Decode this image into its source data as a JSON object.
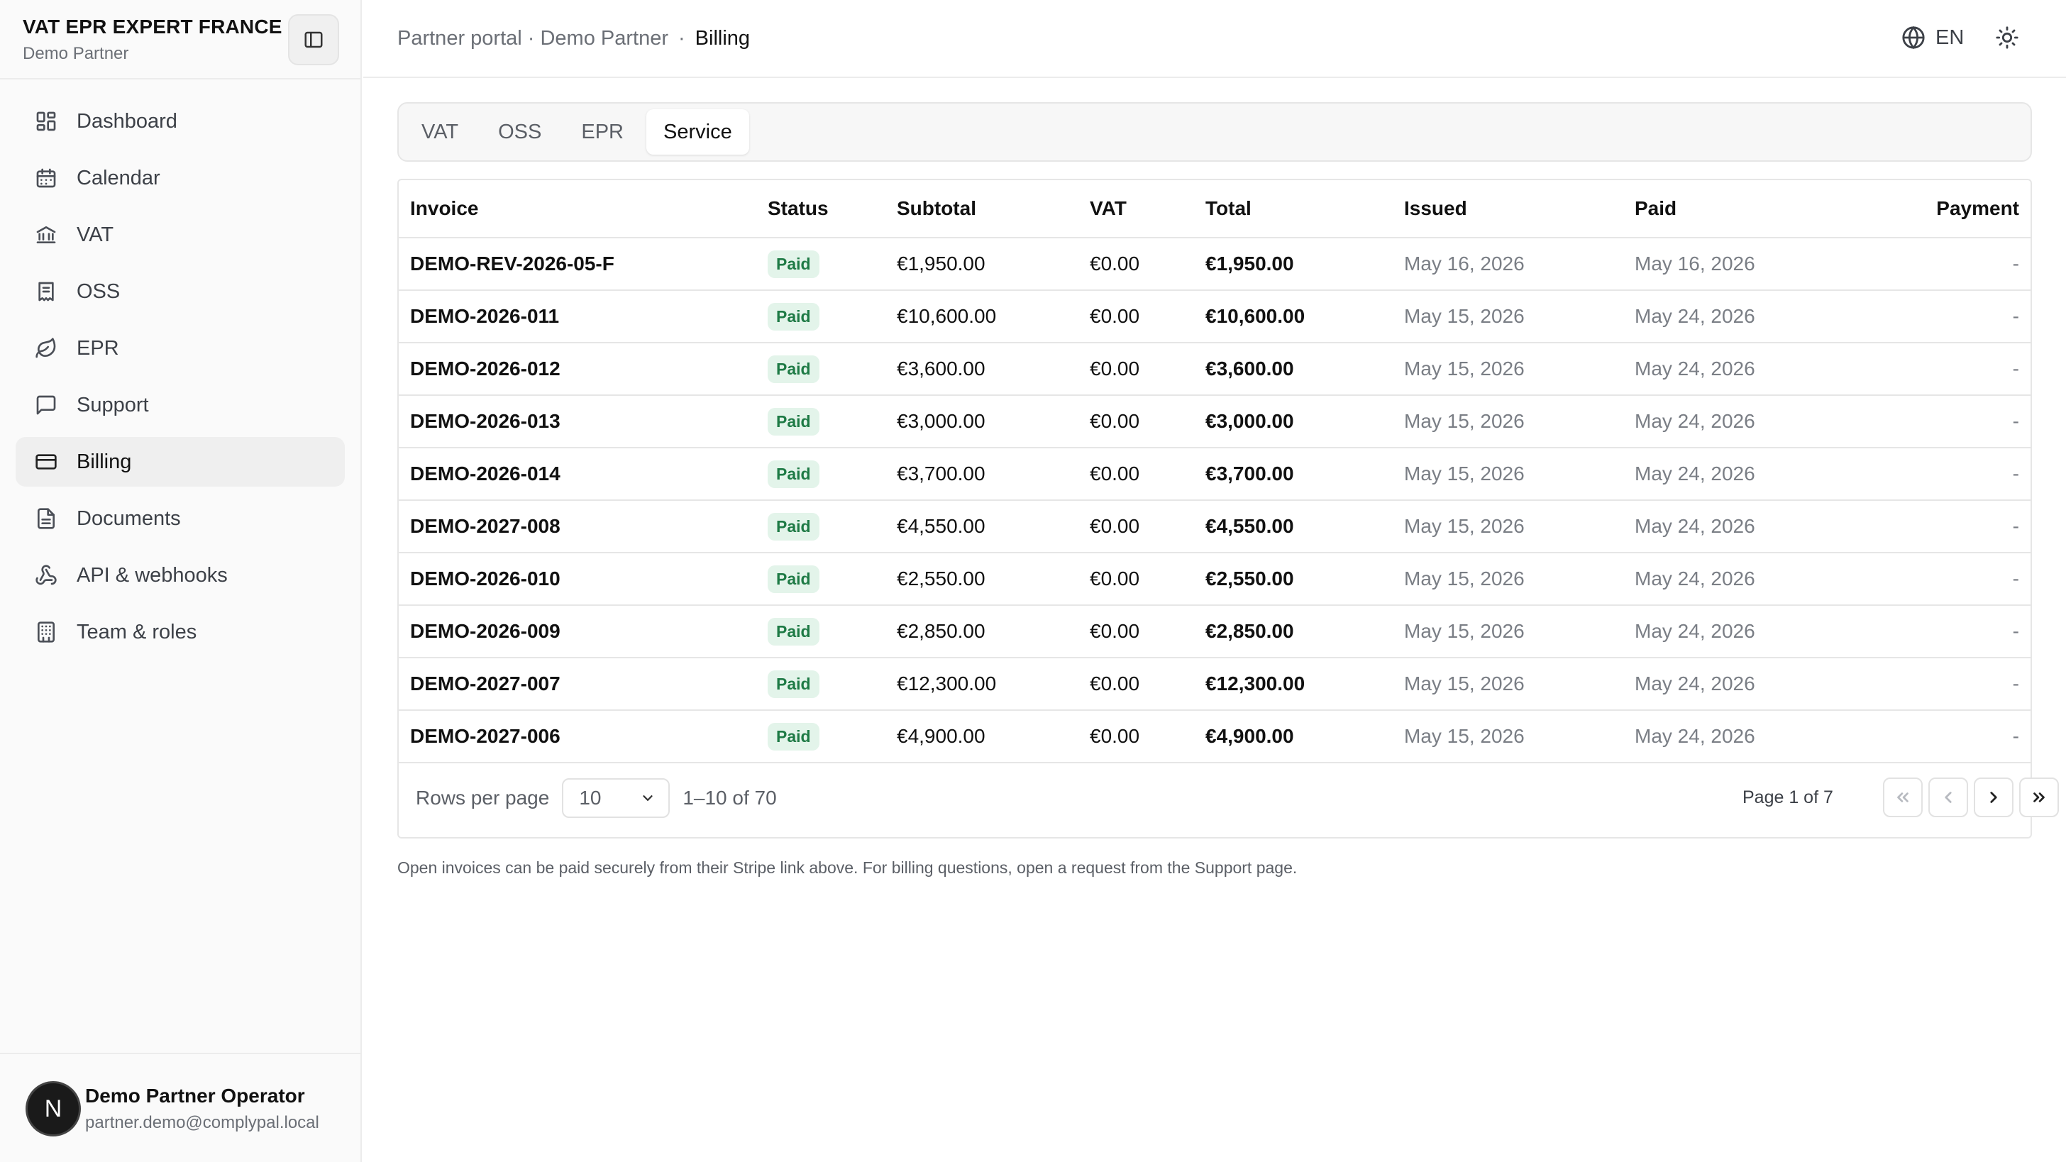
{
  "sidebar": {
    "brand_title": "VAT EPR EXPERT FRANCE",
    "brand_subtitle": "Demo Partner",
    "items": [
      {
        "label": "Dashboard",
        "icon": "dashboard-icon"
      },
      {
        "label": "Calendar",
        "icon": "calendar-icon"
      },
      {
        "label": "VAT",
        "icon": "bank-icon"
      },
      {
        "label": "OSS",
        "icon": "receipt-icon"
      },
      {
        "label": "EPR",
        "icon": "leaf-icon"
      },
      {
        "label": "Support",
        "icon": "chat-icon"
      },
      {
        "label": "Billing",
        "icon": "credit-card-icon",
        "active": true
      },
      {
        "label": "Documents",
        "icon": "document-icon"
      },
      {
        "label": "API & webhooks",
        "icon": "webhook-icon"
      },
      {
        "label": "Team & roles",
        "icon": "building-icon"
      }
    ],
    "user": {
      "initial": "N",
      "name": "Demo Partner Operator",
      "email": "partner.demo@complypal.local"
    }
  },
  "header": {
    "crumb_root": "Partner portal · Demo Partner",
    "crumb_sep": "·",
    "crumb_current": "Billing",
    "language": "EN"
  },
  "tabs": [
    {
      "label": "VAT"
    },
    {
      "label": "OSS"
    },
    {
      "label": "EPR"
    },
    {
      "label": "Service",
      "active": true
    }
  ],
  "table": {
    "columns": {
      "invoice": "Invoice",
      "status": "Status",
      "subtotal": "Subtotal",
      "vat": "VAT",
      "total": "Total",
      "issued": "Issued",
      "paid": "Paid",
      "payment": "Payment"
    },
    "rows": [
      {
        "invoice": "DEMO-REV-2026-05-F",
        "status": "Paid",
        "subtotal": "€1,950.00",
        "vat": "€0.00",
        "total": "€1,950.00",
        "issued": "May 16, 2026",
        "paid": "May 16, 2026",
        "payment": "-"
      },
      {
        "invoice": "DEMO-2026-011",
        "status": "Paid",
        "subtotal": "€10,600.00",
        "vat": "€0.00",
        "total": "€10,600.00",
        "issued": "May 15, 2026",
        "paid": "May 24, 2026",
        "payment": "-"
      },
      {
        "invoice": "DEMO-2026-012",
        "status": "Paid",
        "subtotal": "€3,600.00",
        "vat": "€0.00",
        "total": "€3,600.00",
        "issued": "May 15, 2026",
        "paid": "May 24, 2026",
        "payment": "-"
      },
      {
        "invoice": "DEMO-2026-013",
        "status": "Paid",
        "subtotal": "€3,000.00",
        "vat": "€0.00",
        "total": "€3,000.00",
        "issued": "May 15, 2026",
        "paid": "May 24, 2026",
        "payment": "-"
      },
      {
        "invoice": "DEMO-2026-014",
        "status": "Paid",
        "subtotal": "€3,700.00",
        "vat": "€0.00",
        "total": "€3,700.00",
        "issued": "May 15, 2026",
        "paid": "May 24, 2026",
        "payment": "-"
      },
      {
        "invoice": "DEMO-2027-008",
        "status": "Paid",
        "subtotal": "€4,550.00",
        "vat": "€0.00",
        "total": "€4,550.00",
        "issued": "May 15, 2026",
        "paid": "May 24, 2026",
        "payment": "-"
      },
      {
        "invoice": "DEMO-2026-010",
        "status": "Paid",
        "subtotal": "€2,550.00",
        "vat": "€0.00",
        "total": "€2,550.00",
        "issued": "May 15, 2026",
        "paid": "May 24, 2026",
        "payment": "-"
      },
      {
        "invoice": "DEMO-2026-009",
        "status": "Paid",
        "subtotal": "€2,850.00",
        "vat": "€0.00",
        "total": "€2,850.00",
        "issued": "May 15, 2026",
        "paid": "May 24, 2026",
        "payment": "-"
      },
      {
        "invoice": "DEMO-2027-007",
        "status": "Paid",
        "subtotal": "€12,300.00",
        "vat": "€0.00",
        "total": "€12,300.00",
        "issued": "May 15, 2026",
        "paid": "May 24, 2026",
        "payment": "-"
      },
      {
        "invoice": "DEMO-2027-006",
        "status": "Paid",
        "subtotal": "€4,900.00",
        "vat": "€0.00",
        "total": "€4,900.00",
        "issued": "May 15, 2026",
        "paid": "May 24, 2026",
        "payment": "-"
      }
    ]
  },
  "pager": {
    "rows_label": "Rows per page",
    "rows_value": "10",
    "range": "1–10 of 70",
    "page_info": "Page 1 of 7"
  },
  "footnote": "Open invoices can be paid securely from their Stripe link above. For billing questions, open a request from the Support page.",
  "colors": {
    "paid_badge_bg": "#e3f4ea",
    "paid_badge_text": "#1e7a45",
    "sidebar_bg": "#fafafa",
    "active_nav_bg": "#efefef"
  }
}
